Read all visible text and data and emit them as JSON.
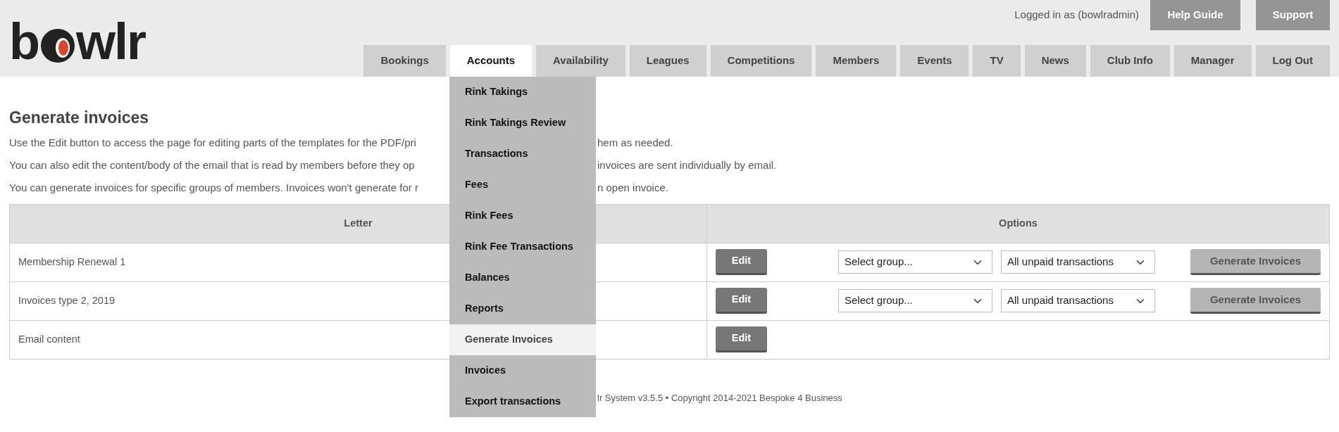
{
  "logo": {
    "before": "b",
    "after": "wlr"
  },
  "user_bar": {
    "logged_in": "Logged in as (bowlradmin)",
    "buttons": [
      "Help Guide",
      "Support"
    ]
  },
  "tabs": [
    {
      "label": "Bookings",
      "selected": false
    },
    {
      "label": "Accounts",
      "selected": true
    },
    {
      "label": "Availability",
      "selected": false
    },
    {
      "label": "Leagues",
      "selected": false
    },
    {
      "label": "Competitions",
      "selected": false
    },
    {
      "label": "Members",
      "selected": false
    },
    {
      "label": "Events",
      "selected": false
    },
    {
      "label": "TV",
      "selected": false
    },
    {
      "label": "News",
      "selected": false
    },
    {
      "label": "Club Info",
      "selected": false
    },
    {
      "label": "Manager",
      "selected": false
    },
    {
      "label": "Log Out",
      "selected": false
    }
  ],
  "accounts_menu": [
    {
      "label": "Rink Takings",
      "selected": false
    },
    {
      "label": "Rink Takings Review",
      "selected": false
    },
    {
      "label": "Transactions",
      "selected": false
    },
    {
      "label": "Fees",
      "selected": false
    },
    {
      "label": "Rink Fees",
      "selected": false
    },
    {
      "label": "Rink Fee Transactions",
      "selected": false
    },
    {
      "label": "Balances",
      "selected": false
    },
    {
      "label": "Reports",
      "selected": false
    },
    {
      "label": "Generate Invoices",
      "selected": true
    },
    {
      "label": "Invoices",
      "selected": false
    },
    {
      "label": "Export transactions",
      "selected": false
    }
  ],
  "page_title": "Generate invoices",
  "paragraphs": [
    {
      "before": "Use the Edit button to access the page for editing parts of the templates for the PDF/pri",
      "after": "hem as needed."
    },
    {
      "before": "You can also edit the content/body of the email that is read by members before they op",
      "after": "invoices are sent individually by email."
    },
    {
      "before": "You can generate invoices for specific groups of members. Invoices won't generate for r",
      "after": "n open invoice."
    }
  ],
  "table": {
    "columns": [
      "Letter",
      "Options"
    ],
    "rows": [
      {
        "letter": "Membership Renewal 1",
        "edit": "Edit",
        "group_select": "Select group...",
        "transaction_select": "All unpaid transactions",
        "generate": "Generate Invoices"
      },
      {
        "letter": "Invoices type 2, 2019",
        "edit": "Edit",
        "group_select": "Select group...",
        "transaction_select": "All unpaid transactions",
        "generate": "Generate Invoices"
      },
      {
        "letter": "Email content",
        "edit": "Edit"
      }
    ]
  },
  "footer": "lr System v3.5.5 • Copyright 2014-2021 Bespoke 4 Business"
}
